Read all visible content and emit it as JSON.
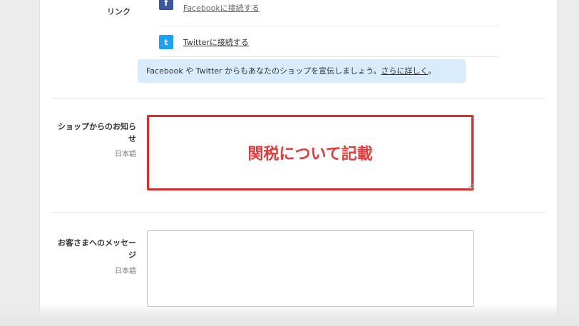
{
  "social": {
    "section_label": "リンク",
    "facebook": {
      "icon": "facebook-icon",
      "icon_glyph": "f",
      "link": "Facebookに接続する"
    },
    "twitter": {
      "icon": "twitter-icon",
      "icon_glyph": "t",
      "link": "Twitterに接続する"
    },
    "info_text": "Facebook や Twitter からもあなたのショップを宣伝しましょう。",
    "info_link": "さらに詳しく",
    "info_end": "。"
  },
  "announcement": {
    "label_line1": "ショップからのお知ら",
    "label_line2": "せ",
    "language": "日本語",
    "value": ""
  },
  "annotation": {
    "text": "関税について記載",
    "color": "#e02b2b"
  },
  "customer_message": {
    "label_line1": "お客さまへのメッセー",
    "label_line2": "ジ",
    "language": "日本語",
    "value": ""
  },
  "colors": {
    "facebook": "#3b5998",
    "twitter": "#1da1f2",
    "info_bg": "#d9ecfb"
  }
}
